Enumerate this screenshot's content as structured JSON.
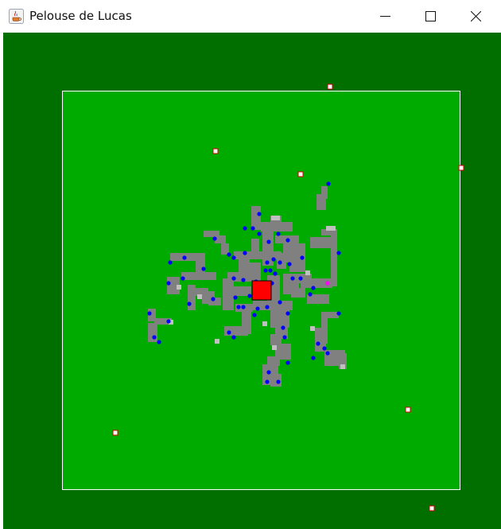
{
  "window": {
    "title": "Pelouse de Lucas",
    "minimize_icon": "minimize-icon",
    "maximize_icon": "maximize-icon",
    "close_icon": "close-icon",
    "app_icon": "java-coffee-cup-icon"
  },
  "colors": {
    "outer_field": "#006f00",
    "lawn": "#00ab00",
    "lawn_border": "#ffffff",
    "mowed_cell": "#808080",
    "light_cell": "#c0c0c0",
    "agent": "#0000ff",
    "special_agent": "#ff00ff",
    "mower_fill": "#ff0000",
    "mower_border": "#000000",
    "marker_fill": "#ffffff",
    "marker_border": "#d00000"
  }
}
